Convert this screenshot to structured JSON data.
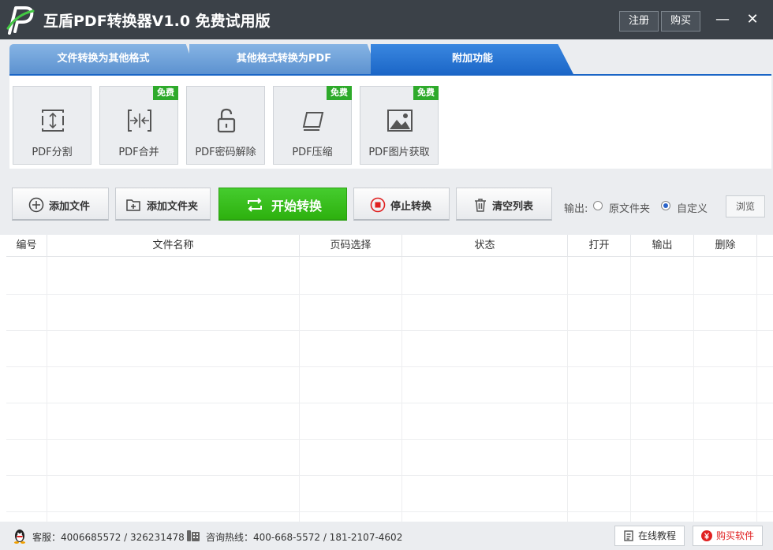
{
  "window": {
    "title": "互盾PDF转换器V1.0 免费试用版",
    "register_label": "注册",
    "buy_label": "购买",
    "minimize_glyph": "—",
    "close_glyph": "✕"
  },
  "tabs": [
    {
      "label": "文件转换为其他格式",
      "active": false
    },
    {
      "label": "其他格式转换为PDF",
      "active": false
    },
    {
      "label": "附加功能",
      "active": true
    }
  ],
  "tools": [
    {
      "label": "PDF分割",
      "icon": "split-icon",
      "badge": ""
    },
    {
      "label": "PDF合并",
      "icon": "merge-icon",
      "badge": "免费"
    },
    {
      "label": "PDF密码解除",
      "icon": "unlock-icon",
      "badge": ""
    },
    {
      "label": "PDF压缩",
      "icon": "compress-icon",
      "badge": "免费"
    },
    {
      "label": "PDF图片获取",
      "icon": "image-icon",
      "badge": "免费"
    }
  ],
  "actions": {
    "add_file": "添加文件",
    "add_folder": "添加文件夹",
    "start": "开始转换",
    "stop": "停止转换",
    "clear": "清空列表"
  },
  "output": {
    "label": "输出:",
    "options": [
      "原文件夹",
      "自定义"
    ],
    "selected": "自定义",
    "browse_label": "浏览"
  },
  "table": {
    "columns": [
      "编号",
      "文件名称",
      "页码选择",
      "状态",
      "打开",
      "输出",
      "删除"
    ],
    "rows": []
  },
  "statusbar": {
    "service": "客服：4006685572 / 326231478",
    "hotline": "咨询热线：400-668-5572 / 181-2107-4602",
    "tutorial_label": "在线教程",
    "buy_label": "购买软件"
  },
  "colors": {
    "titlebar": "#3b4148",
    "tab_active": "#1a65c6",
    "tab_inactive": "#6a9fd9",
    "start_button": "#36b818",
    "free_badge": "#2eaa2b",
    "buy_red": "#e02020"
  }
}
